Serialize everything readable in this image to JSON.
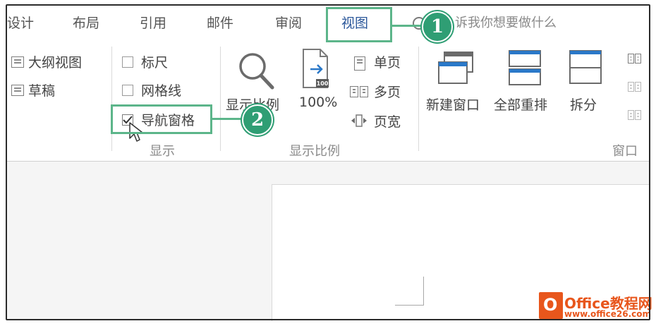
{
  "tabs": [
    {
      "label": "设计",
      "active": false
    },
    {
      "label": "布局",
      "active": false
    },
    {
      "label": "引用",
      "active": false
    },
    {
      "label": "邮件",
      "active": false
    },
    {
      "label": "审阅",
      "active": false
    },
    {
      "label": "视图",
      "active": true
    }
  ],
  "search": {
    "placeholder": "诉我你想要做什么",
    "icon": "search-icon"
  },
  "ribbon": {
    "views": {
      "outline_label": "大纲视图",
      "draft_label": "草稿"
    },
    "show": {
      "group_label": "显示",
      "ruler": {
        "label": "标尺",
        "checked": false
      },
      "gridlines": {
        "label": "网格线",
        "checked": false
      },
      "nav_pane": {
        "label": "导航窗格",
        "checked": true
      }
    },
    "zoom": {
      "group_label": "显示比例",
      "zoom_label": "显示比例",
      "hundred_label": "100%",
      "hundred_icon_text": "100",
      "one_page_label": "单页",
      "multi_page_label": "多页",
      "page_width_label": "页宽"
    },
    "window": {
      "group_label": "窗口",
      "new_window_label": "新建窗口",
      "arrange_all_label": "全部重排",
      "split_label": "拆分"
    }
  },
  "callouts": [
    {
      "number": "1"
    },
    {
      "number": "2"
    }
  ],
  "watermark": {
    "brand": "Office教程网",
    "url": "www.office26.com"
  },
  "colors": {
    "accent": "#2b579a",
    "callout": "#2f9e74",
    "callout_border": "#5cb58a",
    "brand_orange": "#e8561c"
  }
}
